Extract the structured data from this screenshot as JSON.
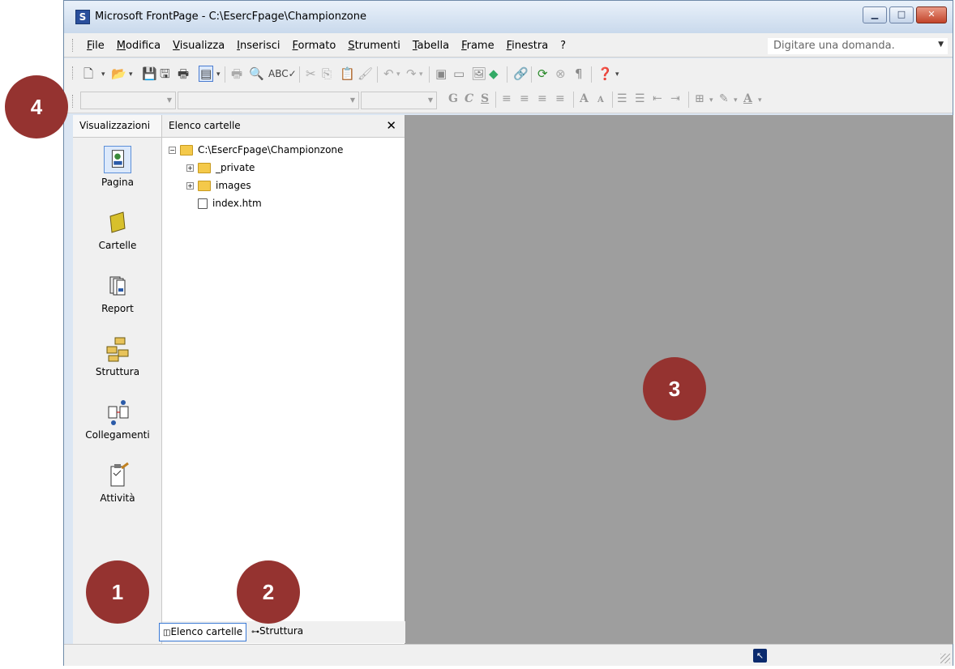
{
  "window": {
    "title": "Microsoft FrontPage - C:\\EsercFpage\\Championzone"
  },
  "menu": {
    "items": [
      "File",
      "Modifica",
      "Visualizza",
      "Inserisci",
      "Formato",
      "Strumenti",
      "Tabella",
      "Frame",
      "Finestra",
      "?"
    ]
  },
  "ask": {
    "placeholder": "Digitare una domanda."
  },
  "views": {
    "title": "Visualizzazioni",
    "items": [
      "Pagina",
      "Cartelle",
      "Report",
      "Struttura",
      "Collegamenti",
      "Attività"
    ]
  },
  "folders": {
    "title": "Elenco cartelle",
    "root": "C:\\EsercFpage\\Championzone",
    "items": [
      "_private",
      "images",
      "index.htm"
    ],
    "tab_folders": "Elenco cartelle",
    "tab_structure": "Struttura"
  },
  "badges": [
    "1",
    "2",
    "3",
    "4"
  ]
}
